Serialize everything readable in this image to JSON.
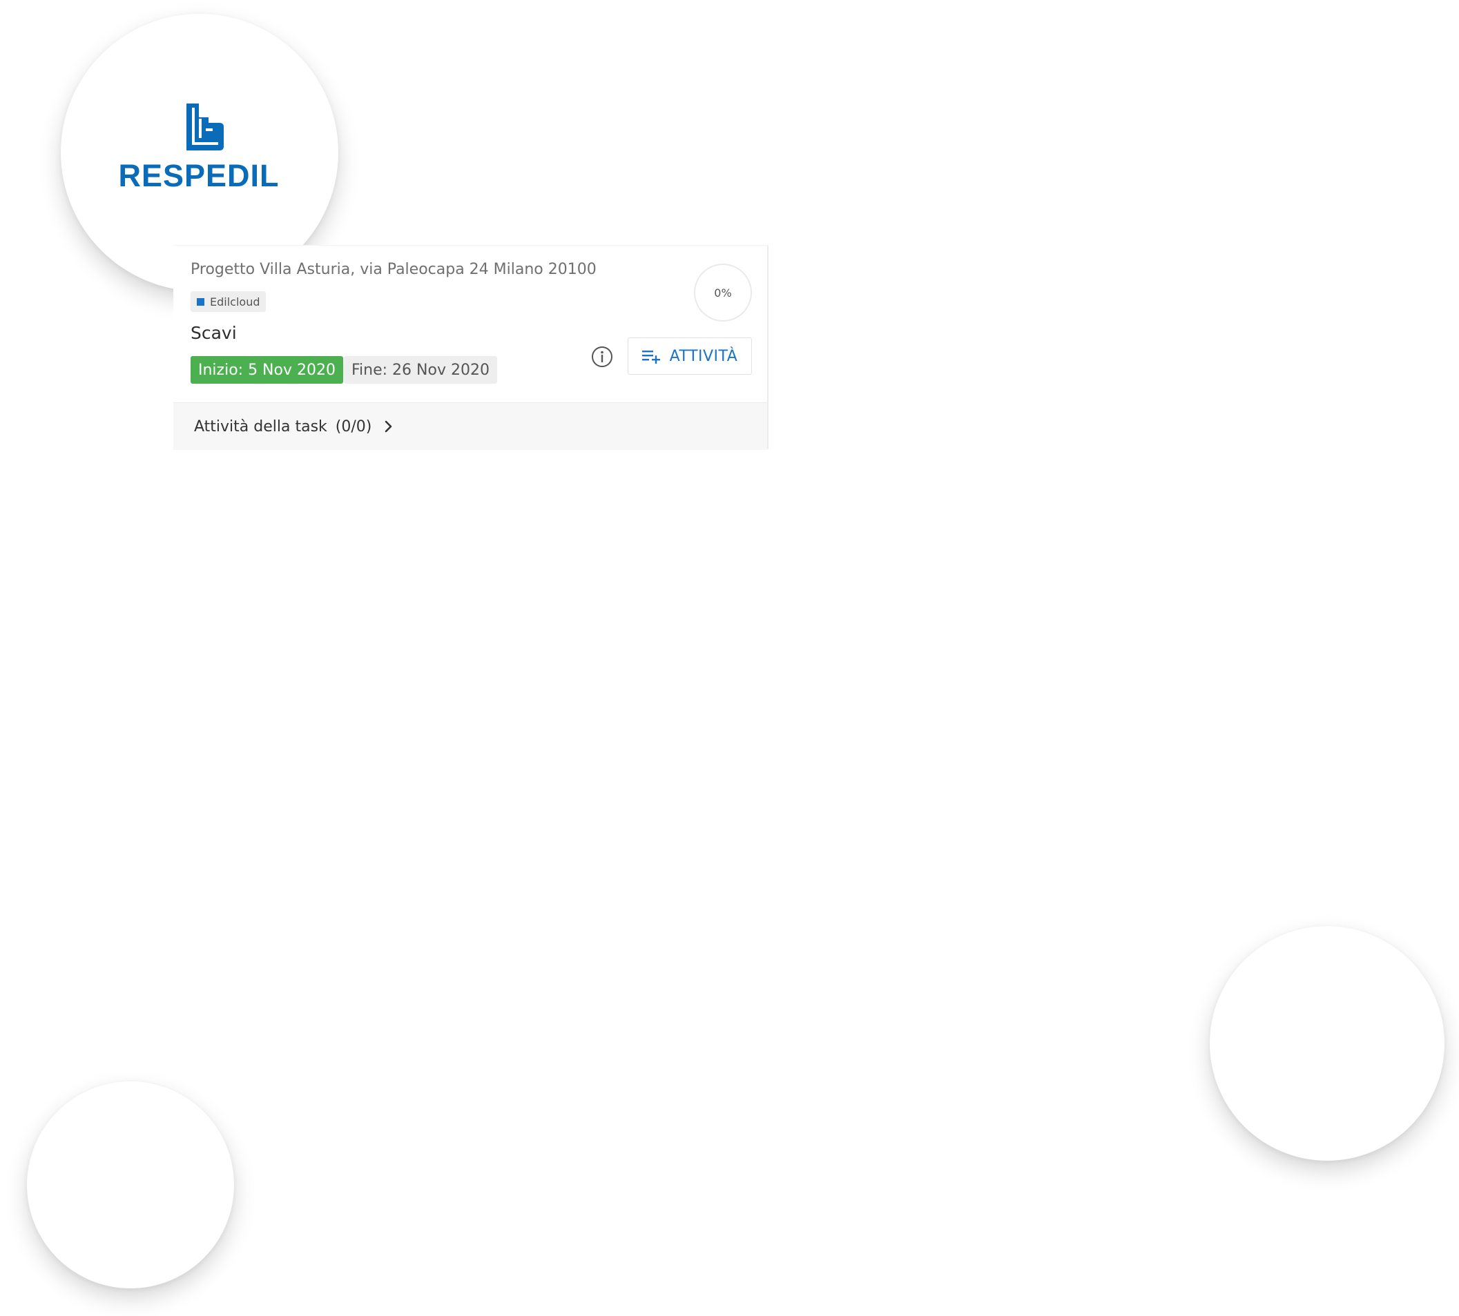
{
  "logo": {
    "text": "RESPEDIL",
    "color": "#0a6cb8"
  },
  "card": {
    "project_title": "Progetto Villa Asturia, via Paleocapa 24 Milano 20100",
    "tag": {
      "label": "Edilcloud",
      "color": "#1a73c8"
    },
    "task_name": "Scavi",
    "start_date": "Inizio: 5 Nov 2020",
    "end_date": "Fine: 26 Nov 2020",
    "progress": {
      "label": "0%",
      "value": 0
    },
    "activity_button_label": "ATTIVITÀ",
    "footer": {
      "label": "Attività della task",
      "count": "(0/0)"
    }
  },
  "colors": {
    "start_badge": "#4caf50",
    "accent": "#1a73c8"
  },
  "icons": [
    "info-icon",
    "playlist-add-icon",
    "chevron-right-icon"
  ]
}
